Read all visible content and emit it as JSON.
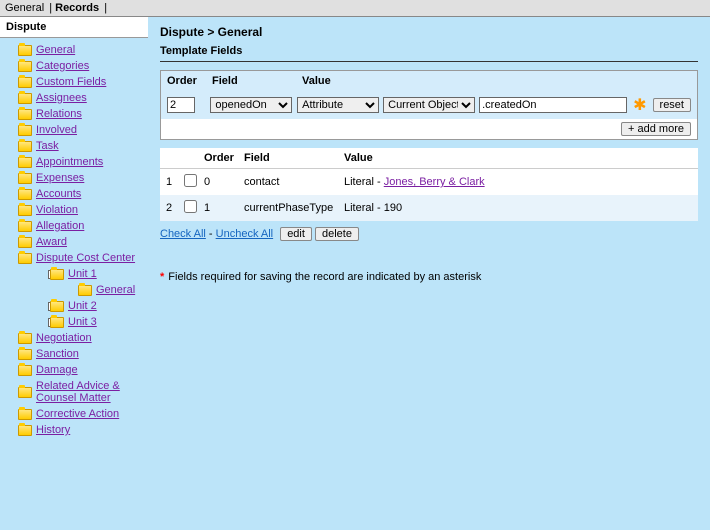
{
  "topTabs": {
    "general": "General",
    "records": "Records"
  },
  "sidebar": {
    "header": "Dispute",
    "items": [
      {
        "label": "General",
        "toggle": null,
        "level": 1
      },
      {
        "label": "Categories",
        "toggle": null,
        "level": 1
      },
      {
        "label": "Custom Fields",
        "toggle": null,
        "level": 1
      },
      {
        "label": "Assignees",
        "toggle": "+",
        "level": 1
      },
      {
        "label": "Relations",
        "toggle": "+",
        "level": 1
      },
      {
        "label": "Involved",
        "toggle": null,
        "level": 1
      },
      {
        "label": "Task",
        "toggle": null,
        "level": 1
      },
      {
        "label": "Appointments",
        "toggle": null,
        "level": 1
      },
      {
        "label": "Expenses",
        "toggle": "+",
        "level": 1
      },
      {
        "label": "Accounts",
        "toggle": null,
        "level": 1
      },
      {
        "label": "Violation",
        "toggle": null,
        "level": 1
      },
      {
        "label": "Allegation",
        "toggle": null,
        "level": 1
      },
      {
        "label": "Award",
        "toggle": "+",
        "level": 1
      },
      {
        "label": "Dispute Cost Center",
        "toggle": "-",
        "level": 1
      },
      {
        "label": "Unit 1",
        "toggle": "-",
        "level": 2
      },
      {
        "label": "General",
        "toggle": null,
        "level": 3
      },
      {
        "label": "Unit 2",
        "toggle": "+",
        "level": 2
      },
      {
        "label": "Unit 3",
        "toggle": "+",
        "level": 2
      },
      {
        "label": "Negotiation",
        "toggle": null,
        "level": 1
      },
      {
        "label": "Sanction",
        "toggle": null,
        "level": 1
      },
      {
        "label": "Damage",
        "toggle": null,
        "level": 1
      },
      {
        "label": "Related Advice & Counsel Matter",
        "toggle": null,
        "level": 1
      },
      {
        "label": "Corrective Action",
        "toggle": null,
        "level": 1
      },
      {
        "label": "History",
        "toggle": "+",
        "level": 1
      }
    ]
  },
  "main": {
    "breadcrumb": "Dispute > General",
    "sectionTitle": "Template Fields",
    "headers": {
      "order": "Order",
      "field": "Field",
      "value": "Value"
    },
    "form": {
      "orderValue": "2",
      "fieldValue": "openedOn",
      "valueType": "Attribute",
      "valueScope": "Current Object",
      "valueAttr": ".createdOn",
      "resetLabel": "reset",
      "addMoreLabel": "+ add more"
    },
    "rows": [
      {
        "num": "1",
        "order": "0",
        "field": "contact",
        "valuePrefix": "Literal - ",
        "valueLink": "Jones, Berry & Clark"
      },
      {
        "num": "2",
        "order": "1",
        "field": "currentPhaseType",
        "valuePrefix": "Literal - 190",
        "valueLink": ""
      }
    ],
    "actions": {
      "checkAll": "Check All",
      "uncheckAll": "Uncheck All",
      "sep": " - ",
      "edit": "edit",
      "delete": "delete"
    },
    "footnote": "Fields required for saving the record are indicated by an asterisk"
  }
}
